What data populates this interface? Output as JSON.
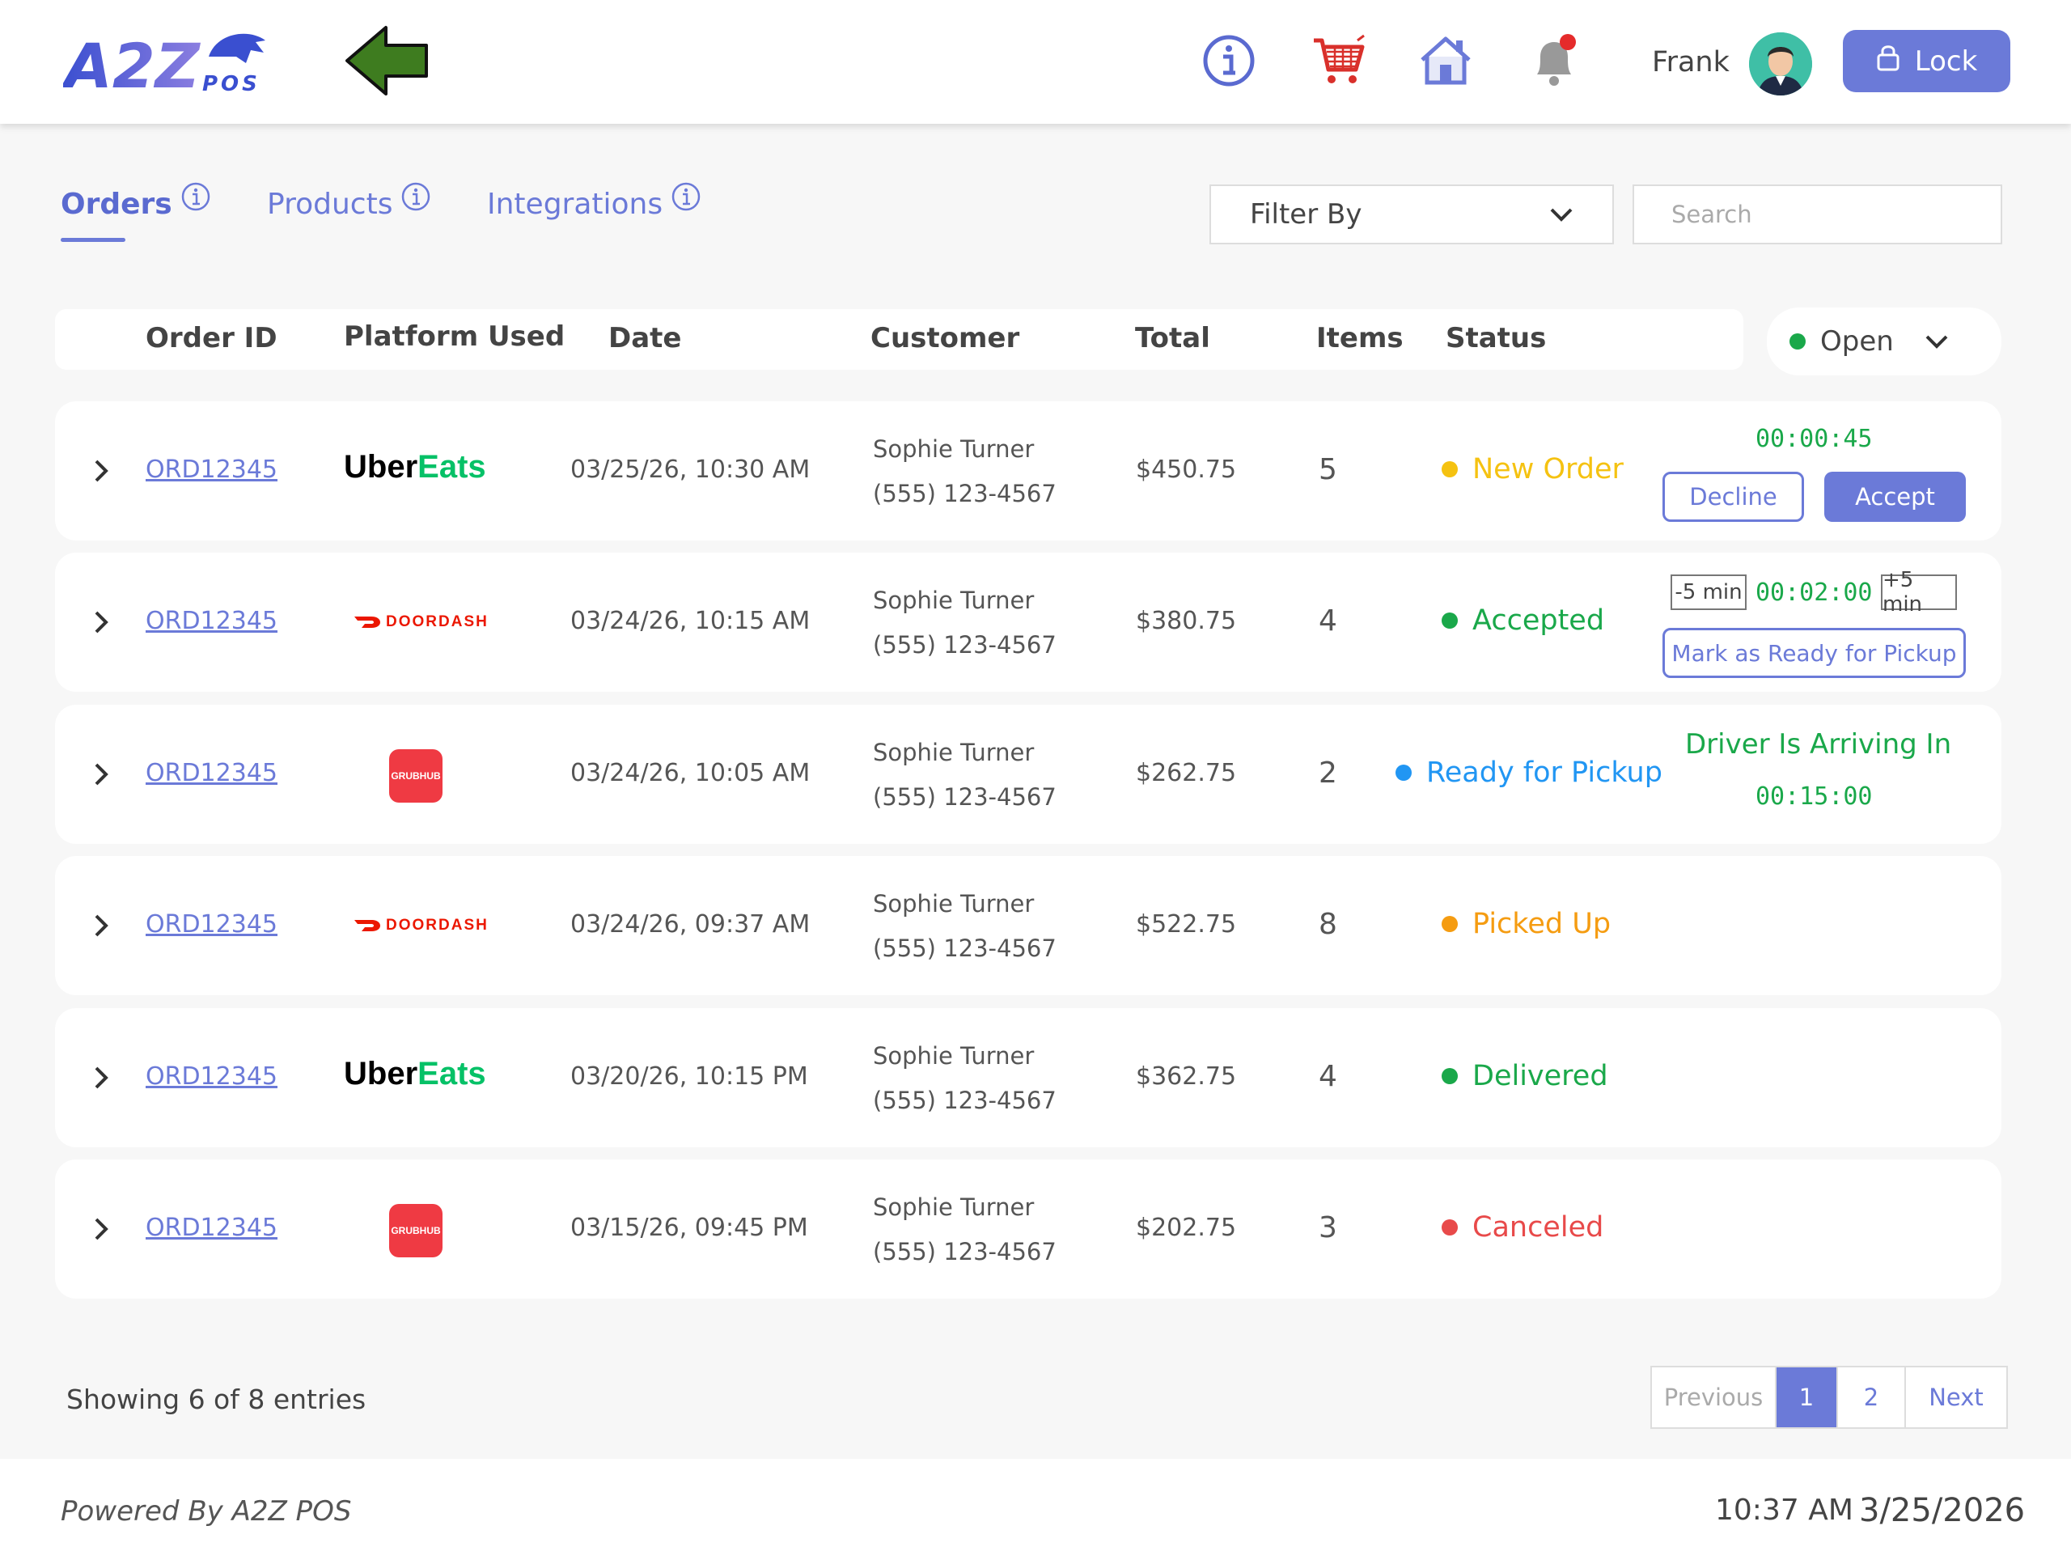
{
  "header": {
    "logo_text": "A2Z",
    "logo_sub": "POS",
    "user_name": "Frank",
    "lock_label": "Lock",
    "icons": [
      "info-icon",
      "cart-icon",
      "home-icon",
      "bell-icon"
    ]
  },
  "tabs": [
    {
      "label": "Orders",
      "active": true
    },
    {
      "label": "Products",
      "active": false
    },
    {
      "label": "Integrations",
      "active": false
    }
  ],
  "filter": {
    "label": "Filter By"
  },
  "search": {
    "placeholder": "Search"
  },
  "table": {
    "headers": [
      "Order ID",
      "Platform Used",
      "Date",
      "Customer",
      "Total",
      "Items",
      "Status"
    ],
    "status_filter": "Open",
    "rows": [
      {
        "order_id": "ORD12345",
        "platform": "Uber Eats",
        "date": "03/25/26, 10:30 AM",
        "customer": "Sophie Turner",
        "phone": "(555) 123-4567",
        "total": "$450.75",
        "items": "5",
        "status": "New Order",
        "status_color": "#f5c211"
      },
      {
        "order_id": "ORD12345",
        "platform": "DoorDash",
        "date": "03/24/26, 10:15 AM",
        "customer": "Sophie Turner",
        "phone": "(555) 123-4567",
        "total": "$380.75",
        "items": "4",
        "status": "Accepted",
        "status_color": "#1aa84a"
      },
      {
        "order_id": "ORD12345",
        "platform": "Grubhub",
        "date": "03/24/26, 10:05 AM",
        "customer": "Sophie Turner",
        "phone": "(555) 123-4567",
        "total": "$262.75",
        "items": "2",
        "status": "Ready for Pickup",
        "status_color": "#2196f3"
      },
      {
        "order_id": "ORD12345",
        "platform": "DoorDash",
        "date": "03/24/26, 09:37 AM",
        "customer": "Sophie Turner",
        "phone": "(555) 123-4567",
        "total": "$522.75",
        "items": "8",
        "status": "Picked Up",
        "status_color": "#f59c11"
      },
      {
        "order_id": "ORD12345",
        "platform": "Uber Eats",
        "date": "03/20/26, 10:15 PM",
        "customer": "Sophie Turner",
        "phone": "(555) 123-4567",
        "total": "$362.75",
        "items": "4",
        "status": "Delivered",
        "status_color": "#1aa84a"
      },
      {
        "order_id": "ORD12345",
        "platform": "Grubhub",
        "date": "03/15/26, 09:45 PM",
        "customer": "Sophie Turner",
        "phone": "(555) 123-4567",
        "total": "$202.75",
        "items": "3",
        "status": "Canceled",
        "status_color": "#e84a4a"
      }
    ],
    "row1_actions": {
      "timer": "00:00:45",
      "decline": "Decline",
      "accept": "Accept"
    },
    "row2_actions": {
      "minus": "-5 min",
      "timer": "00:02:00",
      "plus": "+5 min",
      "ready": "Mark as Ready for Pickup"
    },
    "row3_actions": {
      "driver_label": "Driver Is Arriving In",
      "timer": "00:15:00"
    }
  },
  "platform_logos": {
    "uber_word": "Uber",
    "eats_word": "Eats",
    "doordash_word": "DOORDASH",
    "grubhub_word": "GRUBHUB"
  },
  "pagination": {
    "showing": "Showing 6 of 8 entries",
    "previous": "Previous",
    "pages": [
      "1",
      "2"
    ],
    "current": "1",
    "next": "Next"
  },
  "footer": {
    "powered": "Powered By A2Z POS",
    "time": "10:37 AM",
    "date": "3/25/2026"
  },
  "colors": {
    "accent": "#6b7ad8",
    "green": "#1aa84a",
    "doordash": "#eb1700",
    "grubhub": "#ef3a43",
    "uber_eats_green": "#06c167"
  }
}
